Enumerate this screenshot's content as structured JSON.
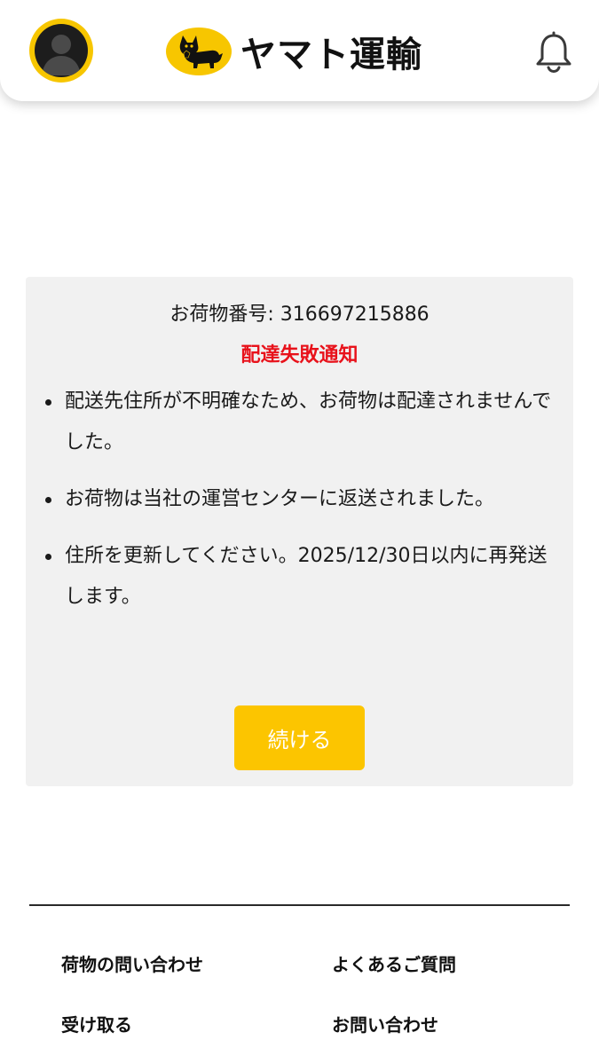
{
  "header": {
    "avatar_icon": "user-avatar-icon",
    "logo_icon": "black-cat-icon",
    "logo_text": "ヤマト運輸",
    "bell_icon": "bell-icon",
    "brand_color": "#f7c600"
  },
  "notice": {
    "tracking_label": "お荷物番号: 316697215886",
    "title": "配達失敗通知",
    "title_color": "#e8121b",
    "messages": [
      "配送先住所が不明確なため、お荷物は配達されませんでした。",
      "お荷物は当社の運営センターに返送されました。",
      "住所を更新してください。2025/12/30日以内に再発送します。"
    ],
    "continue_label": "続ける",
    "button_color": "#fcc500"
  },
  "footer": {
    "links": [
      "荷物の問い合わせ",
      "よくあるご質問",
      "受け取る",
      "お問い合わせ"
    ]
  }
}
